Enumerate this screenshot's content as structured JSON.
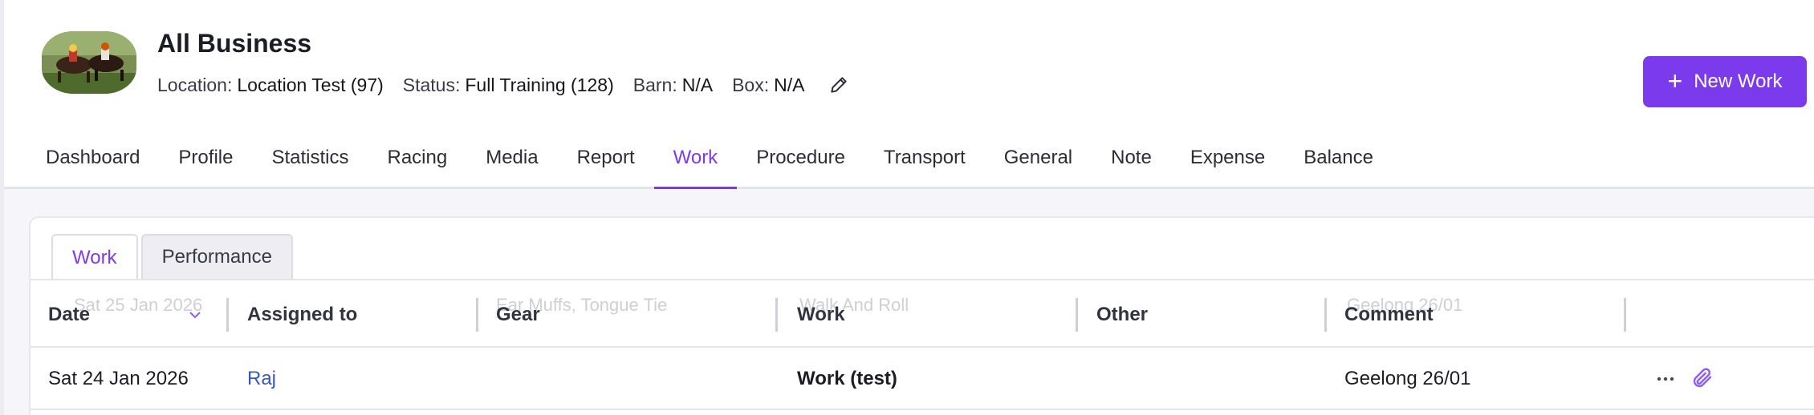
{
  "header": {
    "title": "All Business",
    "meta": [
      {
        "key": "Location:",
        "value": "Location Test (97)"
      },
      {
        "key": "Status:",
        "value": "Full Training (128)"
      },
      {
        "key": "Barn:",
        "value": "N/A"
      },
      {
        "key": "Box:",
        "value": "N/A"
      }
    ],
    "new_button_label": "New Work"
  },
  "nav": {
    "items": [
      "Dashboard",
      "Profile",
      "Statistics",
      "Racing",
      "Media",
      "Report",
      "Work",
      "Procedure",
      "Transport",
      "General",
      "Note",
      "Expense",
      "Balance"
    ],
    "active": "Work"
  },
  "subtabs": {
    "items": [
      "Work",
      "Performance"
    ],
    "active": "Work"
  },
  "table": {
    "columns": [
      "Date",
      "Assigned to",
      "Gear",
      "Work",
      "Other",
      "Comment"
    ],
    "ghost_row": [
      "Sat 25 Jan 2026",
      "Ear Muffs, Tongue Tie",
      "Walk And Roll",
      "Geelong 26/01"
    ],
    "rows": [
      {
        "date": "Sat 24 Jan 2026",
        "assigned_to": "Raj",
        "gear": "",
        "work": "Work (test)",
        "other": "",
        "comment": "Geelong 26/01"
      }
    ]
  },
  "colors": {
    "accent": "#7c3aed",
    "link": "#3a56b8"
  },
  "icons": [
    "horse-photo",
    "pencil-icon",
    "plus-icon",
    "sort-chevron-icon",
    "more-icon",
    "paperclip-icon"
  ]
}
